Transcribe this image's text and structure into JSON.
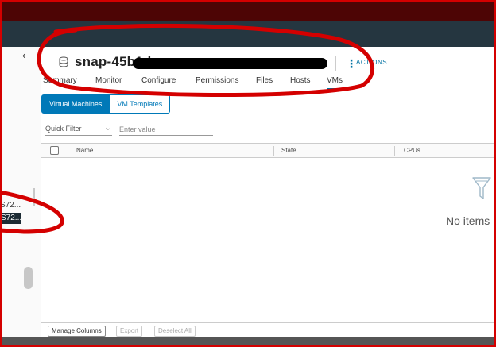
{
  "object": {
    "title": "snap-45b1d",
    "actions_label": "ACTIONS"
  },
  "tabs": [
    {
      "label": "Summary"
    },
    {
      "label": "Monitor"
    },
    {
      "label": "Configure"
    },
    {
      "label": "Permissions"
    },
    {
      "label": "Files"
    },
    {
      "label": "Hosts"
    },
    {
      "label": "VMs",
      "active": true
    }
  ],
  "segmented": {
    "virtual_machines": "Virtual Machines",
    "vm_templates": "VM Templates"
  },
  "filter": {
    "quick_filter": "Quick Filter",
    "placeholder": "Enter value"
  },
  "grid": {
    "columns": [
      "Name",
      "State",
      "CPUs"
    ],
    "empty_message": "No items"
  },
  "footer": {
    "manage_columns": "Manage Columns",
    "export": "Export",
    "deselect_all": "Deselect All"
  },
  "sidebar": {
    "items": [
      {
        "label": "S72..."
      },
      {
        "label": "S72..."
      }
    ]
  },
  "colors": {
    "accent": "#0079b8",
    "annotation": "#d40000",
    "header": "#253640"
  }
}
